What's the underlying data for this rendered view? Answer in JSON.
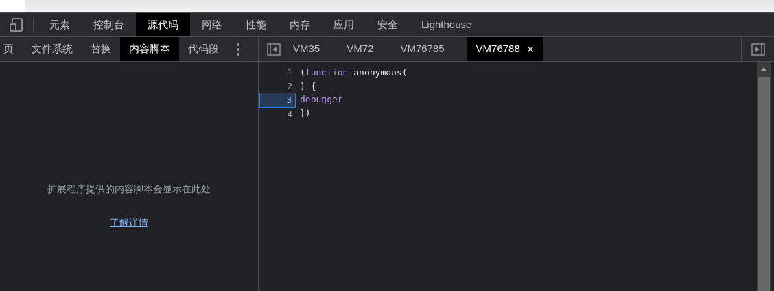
{
  "main_tabs": [
    {
      "label": "元素",
      "selected": false
    },
    {
      "label": "控制台",
      "selected": false
    },
    {
      "label": "源代码",
      "selected": true
    },
    {
      "label": "网络",
      "selected": false
    },
    {
      "label": "性能",
      "selected": false
    },
    {
      "label": "内存",
      "selected": false
    },
    {
      "label": "应用",
      "selected": false
    },
    {
      "label": "安全",
      "selected": false
    },
    {
      "label": "Lighthouse",
      "selected": false
    }
  ],
  "navigator_tabs": [
    {
      "label": "页",
      "selected": false
    },
    {
      "label": "文件系统",
      "selected": false
    },
    {
      "label": "替换",
      "selected": false
    },
    {
      "label": "内容脚本",
      "selected": true
    },
    {
      "label": "代码段",
      "selected": false
    }
  ],
  "navigator": {
    "message": "扩展程序提供的内容脚本会显示在此处",
    "link": "了解详情"
  },
  "editor_tabs": [
    {
      "label": "VM35",
      "selected": false
    },
    {
      "label": "VM72",
      "selected": false
    },
    {
      "label": "VM76785",
      "selected": false
    },
    {
      "label": "VM76788",
      "selected": true,
      "close": "×"
    }
  ],
  "code_lines": [
    {
      "number": "1",
      "paused": false,
      "tokens": [
        {
          "kind": "plain",
          "text": "("
        },
        {
          "kind": "keyword",
          "text": "function"
        },
        {
          "kind": "plain",
          "text": " anonymous("
        }
      ]
    },
    {
      "number": "2",
      "paused": false,
      "tokens": [
        {
          "kind": "plain",
          "text": ") {"
        }
      ]
    },
    {
      "number": "3",
      "paused": true,
      "tokens": [
        {
          "kind": "keyword",
          "text": "debugger"
        }
      ]
    },
    {
      "number": "4",
      "paused": false,
      "tokens": [
        {
          "kind": "plain",
          "text": "})"
        }
      ]
    }
  ]
}
